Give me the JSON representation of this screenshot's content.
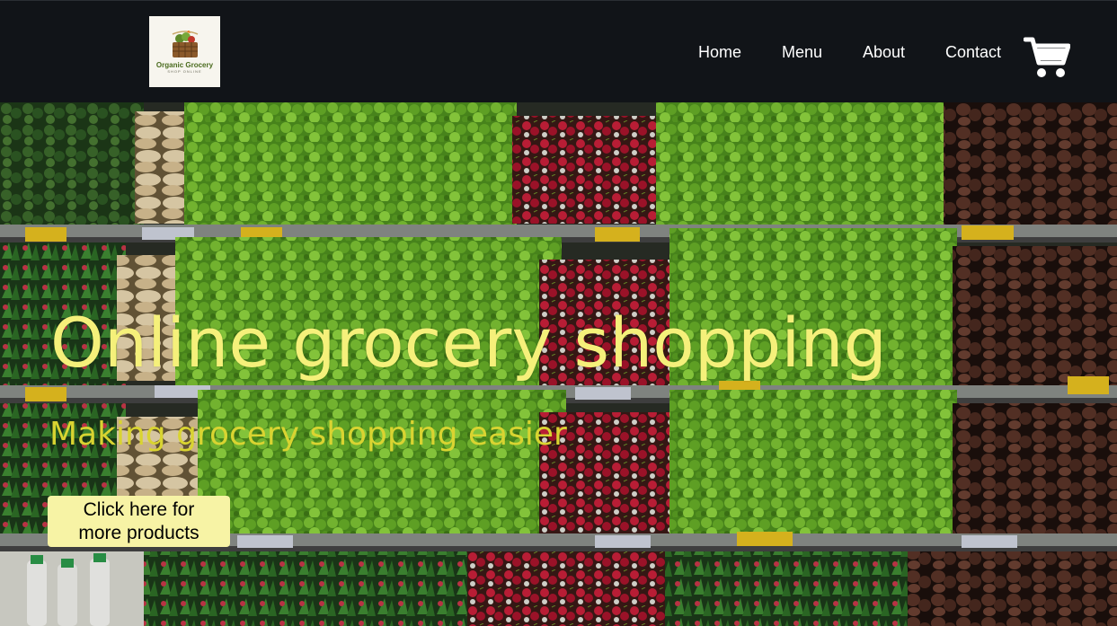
{
  "brand": {
    "logo_title": "Organic Grocery",
    "logo_subtitle": "SHOP ONLINE"
  },
  "nav": {
    "items": [
      {
        "label": "Home"
      },
      {
        "label": "Menu"
      },
      {
        "label": "About"
      },
      {
        "label": "Contact"
      }
    ],
    "cart_icon": "shopping-cart-icon"
  },
  "hero": {
    "title": "Online grocery shopping",
    "subtitle": "Making grocery shopping easier",
    "cta_label_line1": "Click here for",
    "cta_label_line2": "more products",
    "background_image": "vegetable-shelves"
  },
  "colors": {
    "navbar": "#111418",
    "title": "#f5f07a",
    "subtitle": "#d9d431",
    "button": "#f7f3a5"
  }
}
